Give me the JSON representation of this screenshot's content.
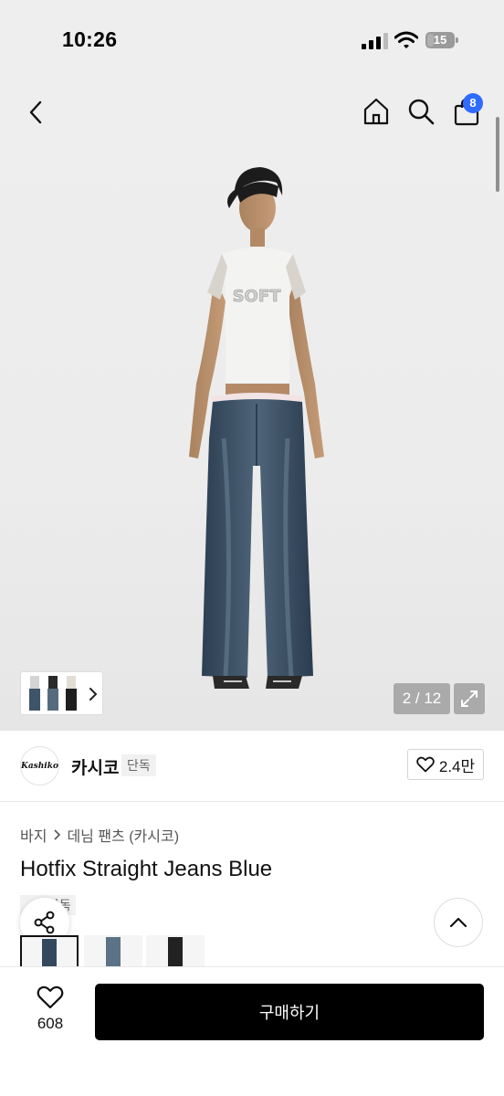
{
  "status": {
    "time": "10:26",
    "battery": "15"
  },
  "nav": {
    "cart_count": "8"
  },
  "gallery": {
    "page_counter": "2 / 12"
  },
  "brand": {
    "logo_text": "Kashiko",
    "name": "카시코",
    "tag": "단독",
    "likes": "2.4만"
  },
  "product": {
    "breadcrumb": [
      "바지",
      "데님 팬츠 (카시코)"
    ],
    "title": "Hotfix Straight Jeans Blue",
    "exclusive_tag": "단독"
  },
  "footer": {
    "wish_count": "608",
    "buy_label": "구매하기"
  },
  "icons": [
    "back-icon",
    "home-icon",
    "search-icon",
    "cart-icon",
    "expand-icon",
    "heart-icon",
    "share-icon",
    "chevron-up-icon"
  ],
  "colors": {
    "accent": "#2f6bff",
    "buy_button": "#000000"
  }
}
